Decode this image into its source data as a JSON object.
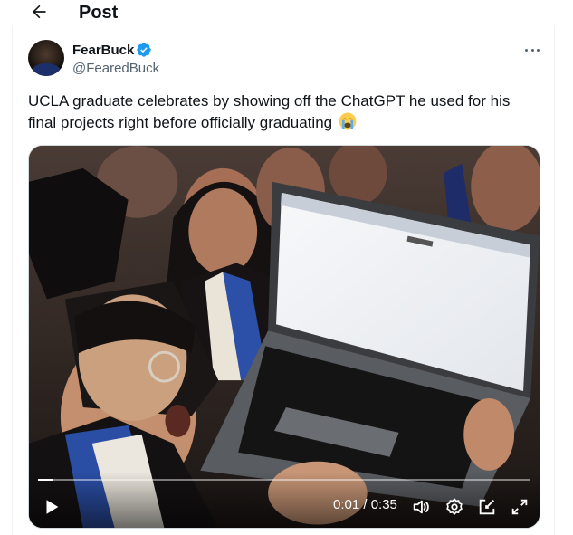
{
  "header": {
    "title": "Post",
    "back_icon": "arrow-left-icon"
  },
  "author": {
    "name": "FearBuck",
    "handle": "@FearedBuck",
    "verified": true,
    "verified_color": "#1d9bf0"
  },
  "post": {
    "text": "UCLA graduate celebrates by showing off the ChatGPT he used for his final projects right before officially graduating",
    "emoji": "loudly-crying-face"
  },
  "video": {
    "time_display": "0:01 / 0:35",
    "progress_fraction": 0.03,
    "controls": [
      "play-icon",
      "volume-icon",
      "settings-gear-icon",
      "pop-out-icon",
      "fullscreen-icon"
    ]
  },
  "colors": {
    "text": "#0f1419",
    "secondary": "#536471",
    "accent": "#1d9bf0"
  }
}
